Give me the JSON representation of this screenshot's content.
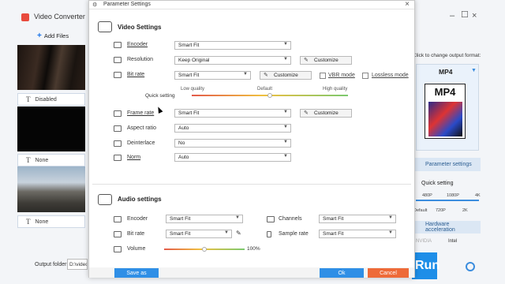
{
  "app": {
    "title": "Video Converter",
    "add_files": "Add Files",
    "output_folder_label": "Output folder:",
    "output_folder_value": "D:\\video ...",
    "window_icons": [
      "minimize-icon",
      "maximize-icon",
      "close-icon"
    ]
  },
  "files": [
    {
      "subtitle": "Disabled"
    },
    {
      "subtitle": "None"
    },
    {
      "subtitle": "None"
    }
  ],
  "right_panel": {
    "hint": "Click to change output format:",
    "format": "MP4",
    "format_icon_label": "MP4",
    "parameter_settings": "Parameter settings",
    "quick_setting": "Quick setting",
    "quick_ticks_top": [
      "480P",
      "1080P",
      "4K"
    ],
    "quick_ticks_bottom": [
      "Default",
      "720P",
      "2K"
    ],
    "hw_accel": "Hardware acceleration",
    "nvidia": "NVIDIA",
    "intel": "Intel",
    "run_label": "Run"
  },
  "dialog": {
    "title": "Parameter Settings",
    "video_section": "Video Settings",
    "encoder_label": "Encoder",
    "encoder_value": "Smart Fit",
    "resolution_label": "Resolution",
    "resolution_value": "Keep Original",
    "customize": "Customize",
    "bitrate_label": "Bit rate",
    "bitrate_value": "Smart Fit",
    "vbr_mode": "VBR mode",
    "lossless_mode": "Lossless mode",
    "quick_setting": "Quick setting",
    "quality_low": "Low quality",
    "quality_default": "Default",
    "quality_high": "High quality",
    "quality_level": 0.5,
    "framerate_label": "Frame rate",
    "framerate_value": "Smart Fit",
    "aspect_label": "Aspect ratio",
    "aspect_value": "Auto",
    "deinterlace_label": "Deinterlace",
    "deinterlace_value": "No",
    "norm_label": "Norm",
    "norm_value": "Auto",
    "audio_section": "Audio settings",
    "a_encoder_label": "Encoder",
    "a_encoder_value": "Smart Fit",
    "channels_label": "Channels",
    "channels_value": "Smart Fit",
    "a_bitrate_label": "Bit rate",
    "a_bitrate_value": "Smart Fit",
    "samplerate_label": "Sample rate",
    "samplerate_value": "Smart Fit",
    "volume_label": "Volume",
    "volume_value": "100%",
    "volume_level": 0.5,
    "save_as": "Save as",
    "ok": "Ok",
    "cancel": "Cancel"
  }
}
